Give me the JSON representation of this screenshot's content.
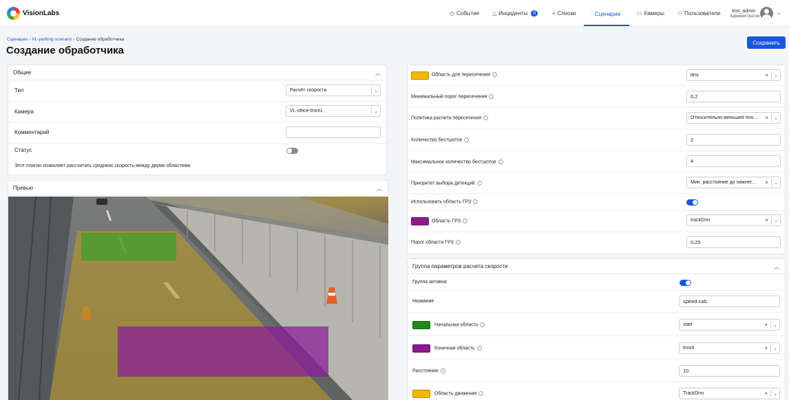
{
  "header": {
    "brand": "VisionLabs",
    "nav": {
      "events": "События",
      "incidents": "Инциденты",
      "incidents_count": "0",
      "lists": "Списки",
      "scenarios": "Сценарии",
      "cameras": "Камеры",
      "users": "Пользователи"
    },
    "user": {
      "name": "test_admin",
      "role": "Администратор"
    },
    "active_color": "#1a56db"
  },
  "breadcrumb": {
    "root": "Сценарии",
    "scenario": "VL-parking-scenario",
    "current": "Создание обработчика"
  },
  "page_title": "Создание обработчика",
  "save_label": "Сохранить",
  "general": {
    "title": "Общие",
    "type_label": "Тип",
    "type_value": "Расчёт скорости",
    "camera_label": "Камера",
    "camera_value": "VL-office-front1",
    "comment_label": "Комментарий",
    "comment_value": "",
    "status_label": "Статус",
    "status_on": false,
    "description": "Этот плагин позволяет рассчитать среднюю скорость между двумя областями"
  },
  "preview": {
    "title": "Превью"
  },
  "settings": {
    "intersection_area": {
      "label": "Область для пересечения",
      "value": "droi",
      "color": "#f5b800"
    },
    "min_threshold": {
      "label": "Минимальный порог пересечения",
      "value": "0,2"
    },
    "policy": {
      "label": "Политика расчета пересечения",
      "value": "Относительно меньшей пло..."
    },
    "bestshots": {
      "label": "Количество бестшотов",
      "value": "2"
    },
    "max_bestshots": {
      "label": "Максимальное количество бестшотов",
      "value": "4"
    },
    "priority": {
      "label": "Приоритет выбора детекций",
      "value": "Мин. расстояние до нижнег..."
    },
    "use_grz": {
      "label": "Использовать область ГРЗ",
      "on": true
    },
    "grz_area": {
      "label": "Область ГРЗ",
      "value": "trackDroi",
      "color": "#8b1a8b"
    },
    "grz_threshold": {
      "label": "Порог области ГРЗ",
      "value": "0,25"
    }
  },
  "speed_group": {
    "title": "Группа параметров расчета скорости",
    "active": {
      "label": "Группа активна",
      "on": true
    },
    "name": {
      "label": "Название",
      "value": "speed calc"
    },
    "start_area": {
      "label": "Начальная область",
      "value": "start",
      "color": "#1b8a1b"
    },
    "end_area": {
      "label": "Конечная область",
      "value": "finish",
      "color": "#8b1a8b"
    },
    "distance": {
      "label": "Расстояние",
      "value": "10"
    },
    "motion_area": {
      "label": "Область движения",
      "value": "TrackDroi",
      "color": "#f5b800"
    }
  }
}
